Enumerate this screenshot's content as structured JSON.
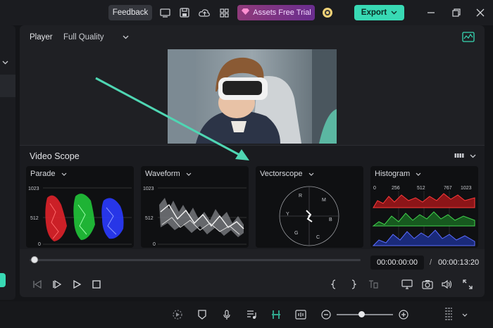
{
  "titlebar": {
    "feedback_label": "Feedback",
    "assets_label": "Assets Free Trial",
    "export_label": "Export"
  },
  "player": {
    "label": "Player",
    "quality": "Full Quality"
  },
  "video_scope": {
    "title": "Video Scope",
    "scopes": [
      {
        "label": "Parade",
        "axis_top": "1023",
        "axis_mid": "512",
        "axis_bottom": "0"
      },
      {
        "label": "Waveform",
        "axis_top": "1023",
        "axis_mid": "512",
        "axis_bottom": "0"
      },
      {
        "label": "Vectorscope",
        "markers": [
          "R",
          "M",
          "B",
          "C",
          "G",
          "Y"
        ]
      },
      {
        "label": "Histogram",
        "ticks": [
          "0",
          "256",
          "512",
          "767",
          "1023"
        ]
      }
    ]
  },
  "transport": {
    "current_time": "00:00:00:00",
    "separator": "/",
    "total_time": "00:00:13:20",
    "progress": 0
  },
  "zoom": {
    "level": 0.45
  },
  "colors": {
    "accent": "#38d9b4",
    "export_bg": "#38d9b4",
    "arrow": "#4fd6b3"
  }
}
